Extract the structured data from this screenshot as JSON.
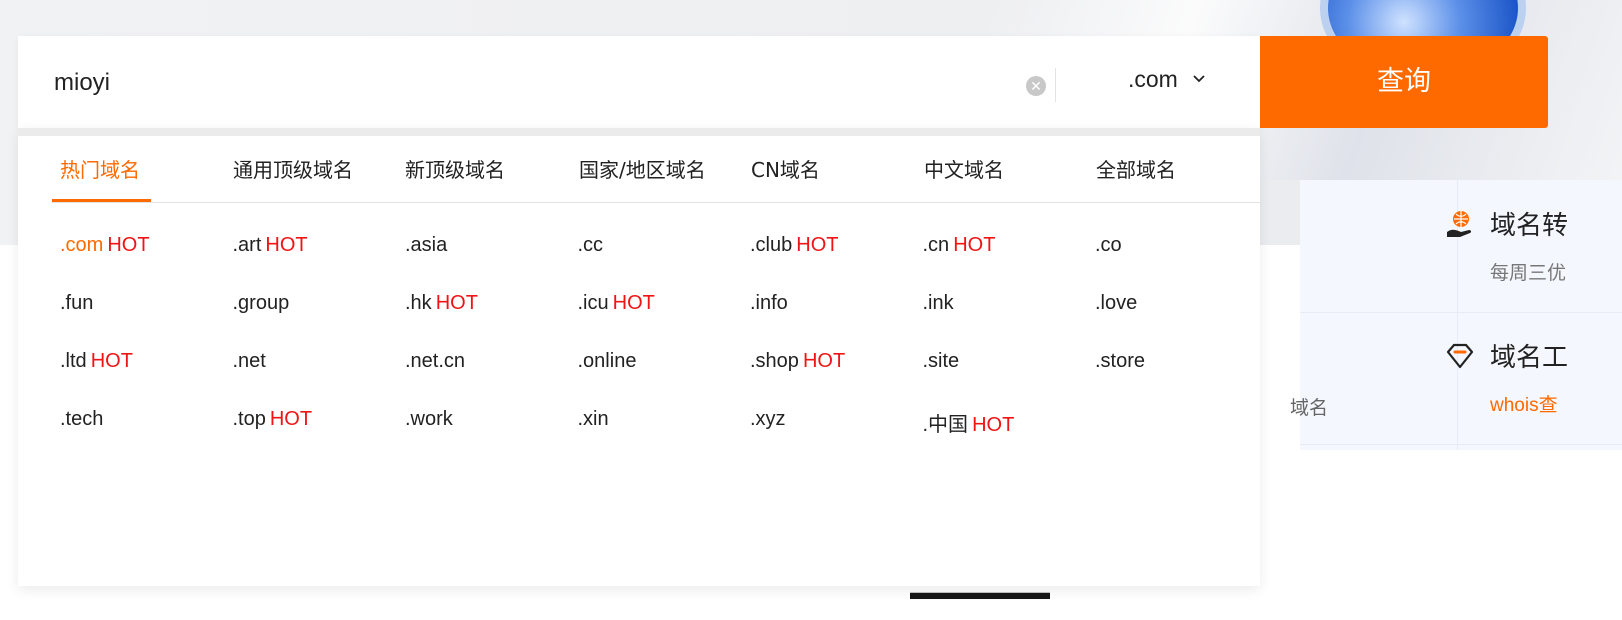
{
  "search": {
    "value": "mioyi",
    "clear_symbol": "✕",
    "suffix": ".com",
    "query_label": "查询"
  },
  "tabs": [
    {
      "label": "热门域名",
      "active": true
    },
    {
      "label": "通用顶级域名"
    },
    {
      "label": "新顶级域名"
    },
    {
      "label": "国家/地区域名"
    },
    {
      "label": "CN域名"
    },
    {
      "label": "中文域名"
    },
    {
      "label": "全部域名"
    }
  ],
  "domains": [
    {
      "name": ".com",
      "hot": "HOT",
      "selected": true
    },
    {
      "name": ".art",
      "hot": "HOT"
    },
    {
      "name": ".asia"
    },
    {
      "name": ".cc"
    },
    {
      "name": ".club",
      "hot": "HOT"
    },
    {
      "name": ".cn",
      "hot": "HOT"
    },
    {
      "name": ".co"
    },
    {
      "name": ".fun"
    },
    {
      "name": ".group"
    },
    {
      "name": ".hk",
      "hot": "HOT"
    },
    {
      "name": ".icu",
      "hot": "HOT"
    },
    {
      "name": ".info"
    },
    {
      "name": ".ink"
    },
    {
      "name": ".love"
    },
    {
      "name": ".ltd",
      "hot": "HOT"
    },
    {
      "name": ".net"
    },
    {
      "name": ".net.cn"
    },
    {
      "name": ".online"
    },
    {
      "name": ".shop",
      "hot": "HOT"
    },
    {
      "name": ".site"
    },
    {
      "name": ".store"
    },
    {
      "name": ".tech"
    },
    {
      "name": ".top",
      "hot": "HOT"
    },
    {
      "name": ".work"
    },
    {
      "name": ".xin"
    },
    {
      "name": ".xyz"
    },
    {
      "name": ".中国",
      "hot": "HOT"
    }
  ],
  "background": {
    "feature1_title": "域名转",
    "feature1_sub": "每周三优",
    "feature2_title": "域名工",
    "feature2_sub": "whois查",
    "fragment": "域名"
  },
  "colors": {
    "accent": "#ff6a00",
    "hot": "#f01414"
  }
}
